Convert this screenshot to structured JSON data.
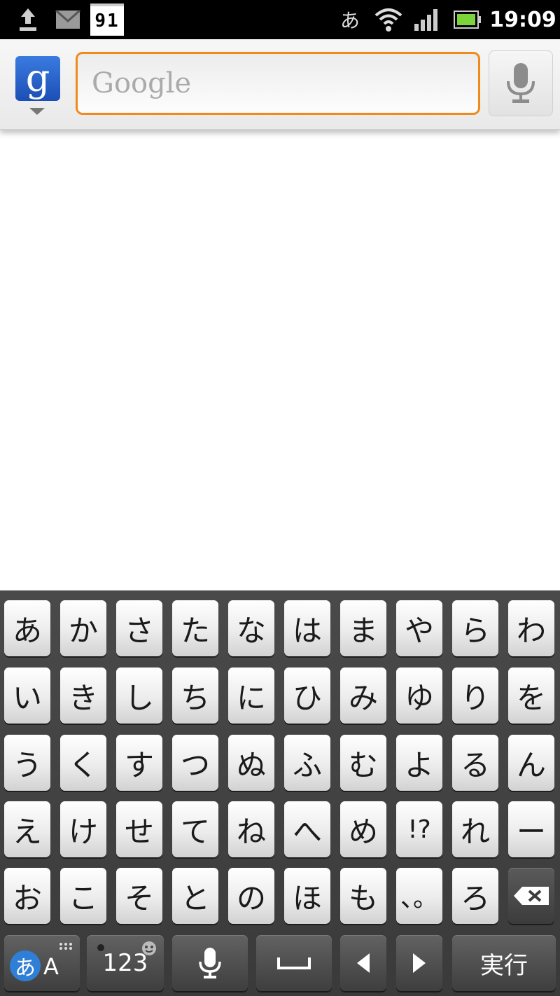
{
  "status_bar": {
    "calendar_day": "91",
    "ime_indicator": "あ",
    "time": "19:09",
    "icons": [
      "upload-icon",
      "mail-icon",
      "calendar-icon",
      "wifi-icon",
      "signal-icon",
      "battery-icon"
    ]
  },
  "search_bar": {
    "logo_letter": "g",
    "placeholder": "Google",
    "value": "",
    "colors": {
      "focus_border": "#f08a1c",
      "logo_bg": "#2a63cc"
    }
  },
  "keyboard": {
    "rows": [
      [
        "あ",
        "か",
        "さ",
        "た",
        "な",
        "は",
        "ま",
        "や",
        "ら",
        "わ"
      ],
      [
        "い",
        "き",
        "し",
        "ち",
        "に",
        "ひ",
        "み",
        "ゆ",
        "り",
        "を"
      ],
      [
        "う",
        "く",
        "す",
        "つ",
        "ぬ",
        "ふ",
        "む",
        "よ",
        "る",
        "ん"
      ],
      [
        "え",
        "け",
        "せ",
        "て",
        "ね",
        "へ",
        "め",
        "!?",
        "れ",
        "ー"
      ],
      [
        "お",
        "こ",
        "そ",
        "と",
        "の",
        "ほ",
        "も",
        "、。",
        "ろ"
      ]
    ],
    "mode_primary": "あ",
    "mode_secondary": "A",
    "num_label": "123",
    "enter_label": "実行",
    "icons": [
      "backspace-icon",
      "mic-icon",
      "space-icon",
      "arrow-left-icon",
      "arrow-right-icon"
    ]
  }
}
